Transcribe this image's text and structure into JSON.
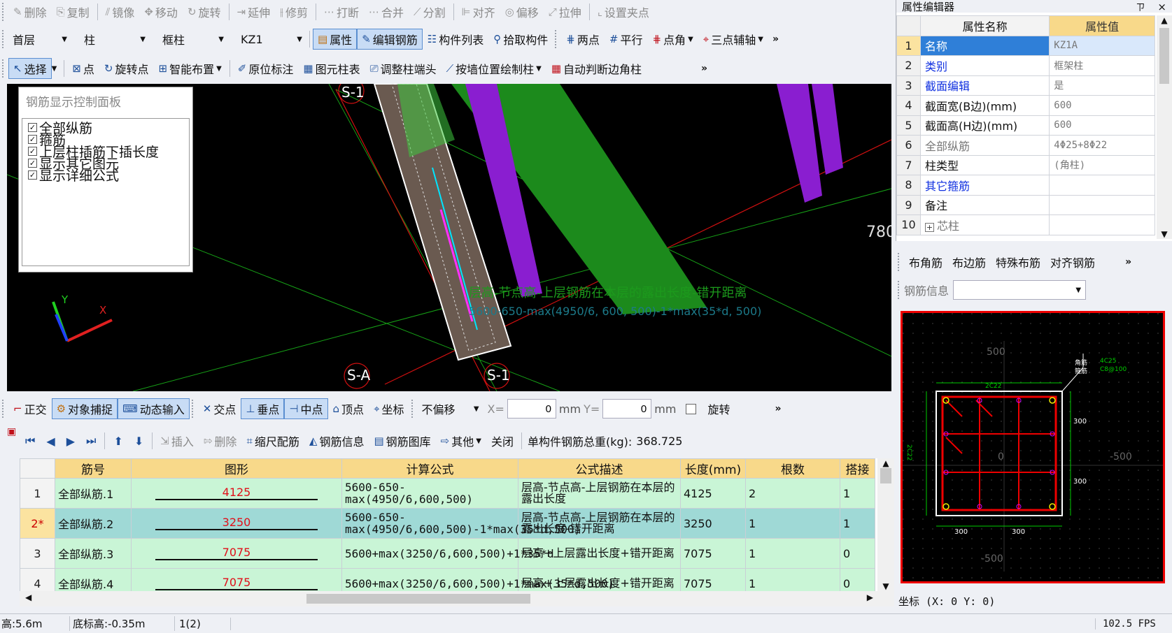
{
  "toolbar1": {
    "items": [
      {
        "icon": "✎",
        "label": "删除"
      },
      {
        "icon": "⎘",
        "label": "复制"
      },
      {
        "icon": "⫽",
        "label": "镜像"
      },
      {
        "icon": "✥",
        "label": "移动"
      },
      {
        "icon": "↻",
        "label": "旋转"
      },
      {
        "icon": "⇥",
        "label": "延伸"
      },
      {
        "icon": "⫲",
        "label": "修剪"
      },
      {
        "icon": "⋯",
        "label": "打断"
      },
      {
        "icon": "⋯",
        "label": "合并"
      },
      {
        "icon": "⟋",
        "label": "分割"
      },
      {
        "icon": "⊫",
        "label": "对齐"
      },
      {
        "icon": "◎",
        "label": "偏移"
      },
      {
        "icon": "⤢",
        "label": "拉伸"
      },
      {
        "icon": "⌞",
        "label": "设置夹点"
      }
    ]
  },
  "toolbar2": {
    "floor": "首层",
    "category": "柱",
    "subtype": "框柱",
    "member": "KZ1",
    "attr": "属性",
    "edit_rebar": "编辑钢筋",
    "member_list": "构件列表",
    "pick": "拾取构件",
    "two_point": "两点",
    "parallel": "平行",
    "point_angle": "点角",
    "three_point": "三点辅轴"
  },
  "toolbar3": {
    "select": "选择",
    "point": "点",
    "rotate_point": "旋转点",
    "smart": "智能布置",
    "label_orig": "原位标注",
    "col_table": "图元柱表",
    "adjust_head": "调整柱端头",
    "wall_draw": "按墙位置绘制柱",
    "auto_corner": "自动判断边角柱"
  },
  "rebar_panel": {
    "title": "钢筋显示控制面板",
    "items": [
      "全部纵筋",
      "箍筋",
      "上层柱插筋下插长度",
      "显示其它图元",
      "显示详细公式"
    ]
  },
  "canvas": {
    "axis_s1_top": "S-1",
    "axis_sa": "S-A",
    "axis_s1_bottom": "S-1",
    "dim_780": "780",
    "anno_line1": "层高-节点高-上层钢筋在本层的露出长度-错开距离",
    "anno_line2": "5600-650-max(4950/6, 600, 500)-1*max(35*d, 500)",
    "axis_y": "Y",
    "axis_x": "X"
  },
  "snapbar": {
    "ortho": "正交",
    "obj_snap": "对象捕捉",
    "dyn_input": "动态输入",
    "intersect": "交点",
    "perp": "垂点",
    "mid": "中点",
    "vertex": "顶点",
    "coord": "坐标",
    "offset": "不偏移",
    "x_label": "X=",
    "x_val": "0",
    "mm1": "mm",
    "y_label": "Y=",
    "y_val": "0",
    "mm2": "mm",
    "rotate": "旋转"
  },
  "gridbar": {
    "insert": "插入",
    "delete": "删除",
    "scale_rebar": "缩尺配筋",
    "rebar_info": "钢筋信息",
    "rebar_lib": "钢筋图库",
    "other": "其他",
    "close": "关闭",
    "total": "单构件钢筋总重(kg):",
    "total_val": "368.725"
  },
  "grid": {
    "headers": [
      "筋号",
      "图形",
      "计算公式",
      "公式描述",
      "长度(mm)",
      "根数",
      "搭接"
    ],
    "rows": [
      {
        "no": "1",
        "name": "全部纵筋.1",
        "shape": "4125",
        "formula": "5600-650-max(4950/6,600,500)",
        "desc": "层高-节点高-上层钢筋在本层的露出长度",
        "len": "4125",
        "count": "2",
        "lap": "1"
      },
      {
        "no": "2*",
        "name": "全部纵筋.2",
        "shape": "3250",
        "formula": "5600-650-max(4950/6,600,500)-1*max(35*d,500)",
        "desc": "层高-节点高-上层钢筋在本层的露出长度-错开距离",
        "len": "3250",
        "count": "1",
        "lap": "1"
      },
      {
        "no": "3",
        "name": "全部纵筋.3",
        "shape": "7075",
        "formula": "5600+max(3250/6,600,500)+1*35*d",
        "desc": "层高+上层露出长度+错开距离",
        "len": "7075",
        "count": "1",
        "lap": "0"
      },
      {
        "no": "4",
        "name": "全部纵筋.4",
        "shape": "7075",
        "formula": "5600+max(3250/6,600,500)+1*max(35*d,500)",
        "desc": "层高+上层露出长度+错开距离",
        "len": "7075",
        "count": "1",
        "lap": "0"
      }
    ]
  },
  "props": {
    "title": "属性编辑器",
    "pin": "ㄗ",
    "close": "×",
    "col_name": "属性名称",
    "col_val": "属性值",
    "rows": [
      {
        "n": "1",
        "name": "名称",
        "val": "KZ1A",
        "link": true
      },
      {
        "n": "2",
        "name": "类别",
        "val": "框架柱",
        "link": true
      },
      {
        "n": "3",
        "name": "截面编辑",
        "val": "是",
        "link": true
      },
      {
        "n": "4",
        "name": "截面宽(B边)(mm)",
        "val": "600",
        "link": false
      },
      {
        "n": "5",
        "name": "截面高(H边)(mm)",
        "val": "600",
        "link": false
      },
      {
        "n": "6",
        "name": "全部纵筋",
        "val": "4Φ25+8Φ22",
        "link": false,
        "gray": true
      },
      {
        "n": "7",
        "name": "柱类型",
        "val": "(角柱)",
        "link": false
      },
      {
        "n": "8",
        "name": "其它箍筋",
        "val": "",
        "link": true
      },
      {
        "n": "9",
        "name": "备注",
        "val": "",
        "link": false
      },
      {
        "n": "10",
        "name": "芯柱",
        "val": "",
        "link": false,
        "gray": true
      }
    ]
  },
  "rebar_tabs": {
    "corner": "布角筋",
    "edge": "布边筋",
    "special": "特殊布筋",
    "align": "对齐钢筋",
    "info_label": "钢筋信息"
  },
  "section": {
    "d500t": "500",
    "d500b": "-500",
    "d500r": "-500",
    "d0": "0",
    "d300l": "300",
    "d300r": "300",
    "d300v1": "300",
    "d300v2": "300",
    "top_lbl": "2C22",
    "side_lbl": "2C22",
    "tag1": "角筋",
    "tag2": "箍筋",
    "tag_val1": "4C25",
    "tag_val2": "C8@100"
  },
  "coord": "坐标 (X: 0 Y: 0)",
  "status": {
    "height": "高:5.6m",
    "base": "底标高:-0.35m",
    "count": "1(2)",
    "fps": "102.5 FPS"
  }
}
